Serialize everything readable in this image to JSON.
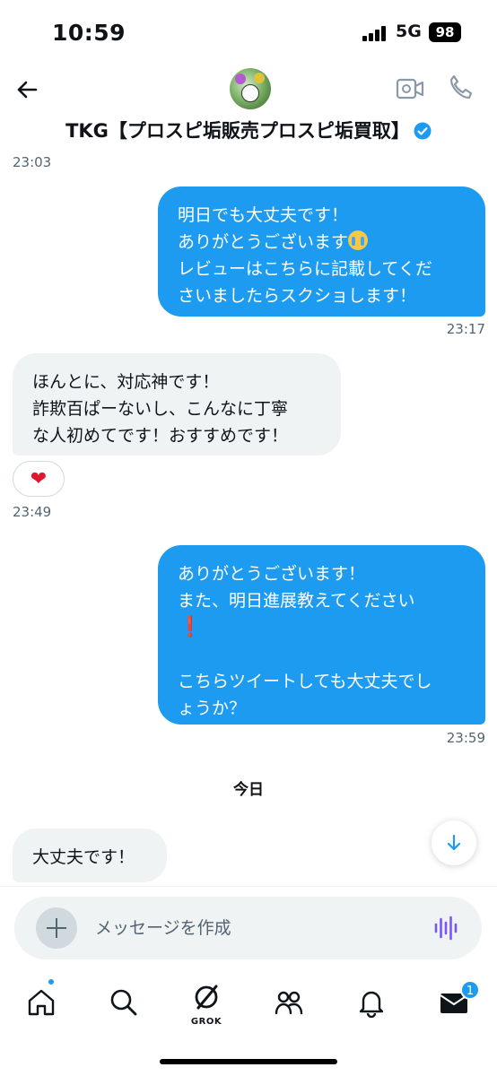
{
  "status_bar": {
    "time": "10:59",
    "network": "5G",
    "battery": "98"
  },
  "header": {
    "title": "TKG【プロスピ垢販売プロスピ垢買取】",
    "verified": true
  },
  "messages": [
    {
      "kind": "timestamp",
      "text": "23:03"
    },
    {
      "kind": "sent",
      "lines": [
        "明日でも大丈夫です！",
        "ありがとうございます",
        "レビューはこちらに記載してくだ",
        "さいましたらスクショします！"
      ],
      "emoji_after_line_2": "crying-face"
    },
    {
      "kind": "timestamp",
      "text": "23:17"
    },
    {
      "kind": "received",
      "lines": [
        "ほんとに、対応神です！",
        "詐欺百ぱーないし、こんなに丁寧",
        "な人初めてです！おすすめです！"
      ],
      "reaction": "❤"
    },
    {
      "kind": "timestamp",
      "text": "23:49"
    },
    {
      "kind": "sent",
      "lines": [
        "ありがとうございます！",
        "また、明日進展教えてください",
        "❗",
        "",
        "こちらツイートしても大丈夫でし",
        "ょうか？"
      ]
    },
    {
      "kind": "timestamp",
      "text": "23:59"
    },
    {
      "kind": "date_separator",
      "text": "今日"
    },
    {
      "kind": "received",
      "lines": [
        "大丈夫です！"
      ]
    }
  ],
  "composer": {
    "placeholder": "メッセージを作成"
  },
  "bottom_nav": {
    "grok_label": "GROK",
    "messages_badge": "1"
  },
  "colors": {
    "accent": "#1d9bf0",
    "received_bubble": "#eff3f4",
    "voice_icon": "#7856ff"
  }
}
